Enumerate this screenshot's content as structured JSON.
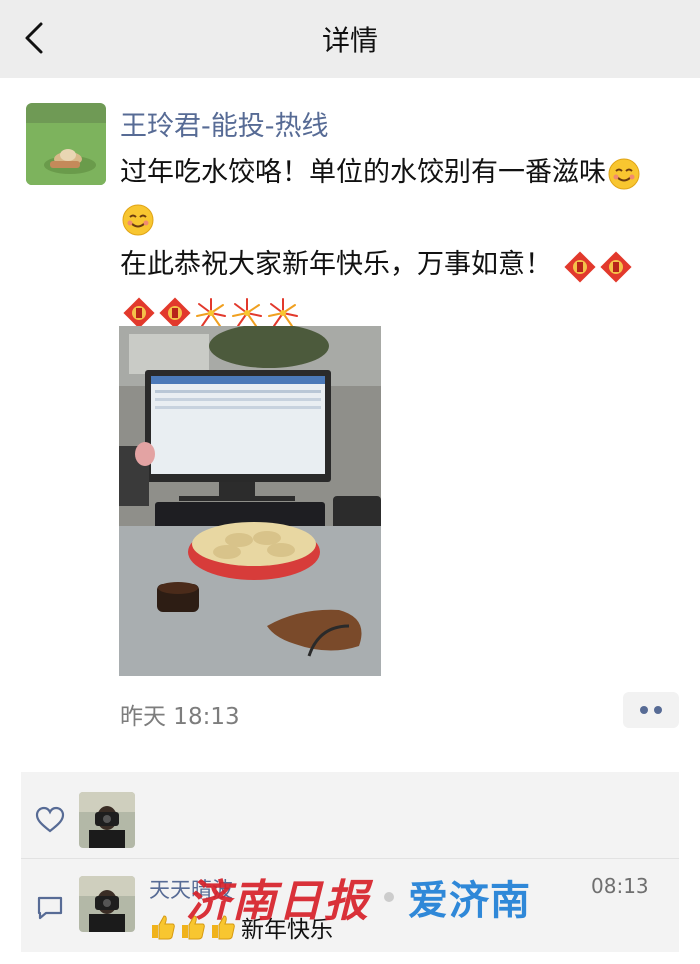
{
  "header": {
    "title": "详情"
  },
  "post": {
    "author": "王玲君-能投-热线",
    "line1_text": "过年吃水饺咯！单位的水饺别有一番滋味",
    "line2_text": "在此恭祝大家新年快乐，万事如意！",
    "time": "昨天 18:13",
    "photo_monitor_caption": "",
    "emojis": [
      "smile-emoji",
      "fu-emoji",
      "firework-emoji"
    ]
  },
  "interactions": {
    "comment": {
      "user": "天天晴波",
      "time": "08:13",
      "text": "新年快乐"
    }
  },
  "watermark": {
    "left_text": "济南日报",
    "right_text": "爱济南"
  },
  "colors": {
    "header_bg": "#ededed",
    "link_blue": "#576b95",
    "panel_bg": "#f3f3f3",
    "watermark_red": "#d7212a",
    "watermark_blue": "#1f7fd6"
  }
}
